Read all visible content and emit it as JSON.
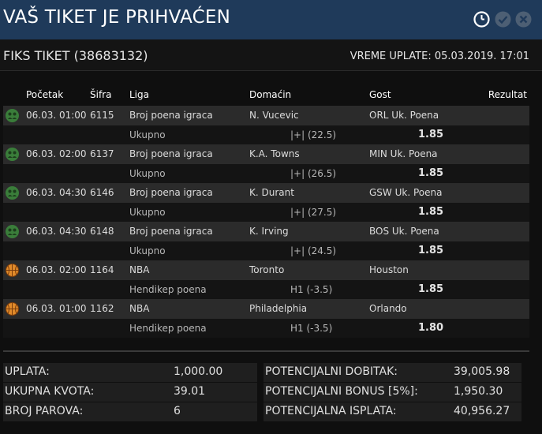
{
  "header": {
    "title": "VAŠ TIKET JE PRIHVAĆEN"
  },
  "ticket": {
    "label": "FIKS TIKET (38683132)",
    "payment_time": "VREME UPLATE: 05.03.2019. 17:01"
  },
  "table": {
    "columns": [
      "Početak",
      "Šifra",
      "Liga",
      "Domaćin",
      "Gost",
      "Rezultat"
    ],
    "rows": [
      {
        "icon": "player-points-icon",
        "start": "06.03. 01:00",
        "code": "6115",
        "league": "Broj poena igraca",
        "home": "N. Vucevic",
        "away": "ORL Uk. Poena",
        "bet_type": "Ukupno",
        "pick": "|+| (22.5)",
        "odds": "1.85"
      },
      {
        "icon": "player-points-icon",
        "start": "06.03. 02:00",
        "code": "6137",
        "league": "Broj poena igraca",
        "home": "K.A. Towns",
        "away": "MIN Uk. Poena",
        "bet_type": "Ukupno",
        "pick": "|+| (26.5)",
        "odds": "1.85"
      },
      {
        "icon": "player-points-icon",
        "start": "06.03. 04:30",
        "code": "6146",
        "league": "Broj poena igraca",
        "home": "K. Durant",
        "away": "GSW Uk. Poena",
        "bet_type": "Ukupno",
        "pick": "|+| (27.5)",
        "odds": "1.85"
      },
      {
        "icon": "player-points-icon",
        "start": "06.03. 04:30",
        "code": "6148",
        "league": "Broj poena igraca",
        "home": "K. Irving",
        "away": "BOS Uk. Poena",
        "bet_type": "Ukupno",
        "pick": "|+| (24.5)",
        "odds": "1.85"
      },
      {
        "icon": "basketball-icon",
        "start": "06.03. 02:00",
        "code": "1164",
        "league": "NBA",
        "home": "Toronto",
        "away": "Houston",
        "bet_type": "Hendikep poena",
        "pick": "H1 (-3.5)",
        "odds": "1.85"
      },
      {
        "icon": "basketball-icon",
        "start": "06.03. 01:00",
        "code": "1162",
        "league": "NBA",
        "home": "Philadelphia",
        "away": "Orlando",
        "bet_type": "Hendikep poena",
        "pick": "H1 (-3.5)",
        "odds": "1.80"
      }
    ]
  },
  "summary": {
    "stake_label": "UPLATA:",
    "stake_value": "1,000.00",
    "total_odds_label": "UKUPNA KVOTA:",
    "total_odds_value": "39.01",
    "pairs_label": "BROJ PAROVA:",
    "pairs_value": "6",
    "potential_win_label": "POTENCIJALNI DOBITAK:",
    "potential_win_value": "39,005.98",
    "bonus_label": "POTENCIJALNI BONUS [5%]:",
    "bonus_value": "1,950.30",
    "payout_label": "POTENCIJALNA ISPLATA:",
    "payout_value": "40,956.27"
  },
  "colors": {
    "titlebar": "#1f3a5a",
    "row_main": "#2b2b2b",
    "row_sub": "#141414",
    "player_icon_bg": "#3a7d3a",
    "basketball": "#e08a2a"
  }
}
